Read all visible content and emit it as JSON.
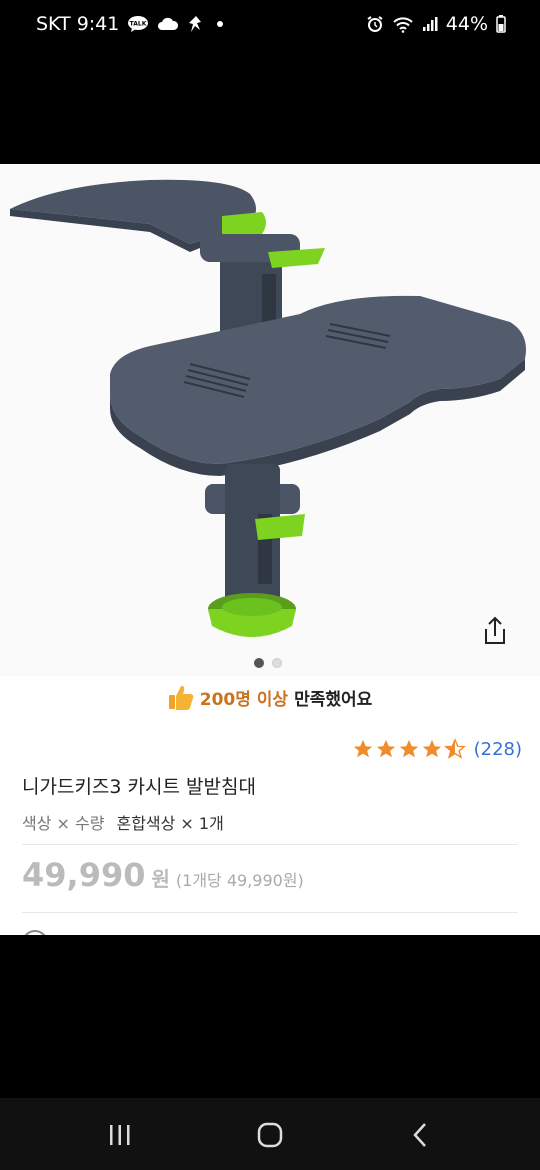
{
  "status_bar": {
    "carrier_time": "SKT 9:41",
    "battery": "44%",
    "icons": [
      "talk-icon",
      "cloud-icon",
      "app-icon",
      "alarm-icon",
      "wifi-icon",
      "signal-icon",
      "battery-icon"
    ],
    "talk_badge": "TALK"
  },
  "product": {
    "image_icon": "car-seat-footrest-image",
    "carousel": {
      "count": 2,
      "active_index": 0
    },
    "share_icon": "share-icon"
  },
  "satisfaction": {
    "icon": "thumbs-up-icon",
    "highlight": "200명 이상",
    "rest": "만족했어요"
  },
  "rating": {
    "stars": 4.5,
    "max_stars": 5,
    "review_count": "(228)",
    "star_color": "#f08c2e"
  },
  "title": "니가드키즈3 카시트 발받침대",
  "options": {
    "label": "색상 × 수량",
    "value": "혼합색상 × 1개"
  },
  "price": {
    "amount": "49,990",
    "currency": "원",
    "unit_price": "(1개당 49,990원)"
  },
  "nav": {
    "recent_icon": "recent-apps-icon",
    "home_icon": "home-icon",
    "back_icon": "back-icon"
  },
  "colors": {
    "accent_green": "#7ed321",
    "product_gray": "#4b5566",
    "rating_link": "#3a6fd8",
    "satisfaction_highlight": "#c9731f"
  }
}
